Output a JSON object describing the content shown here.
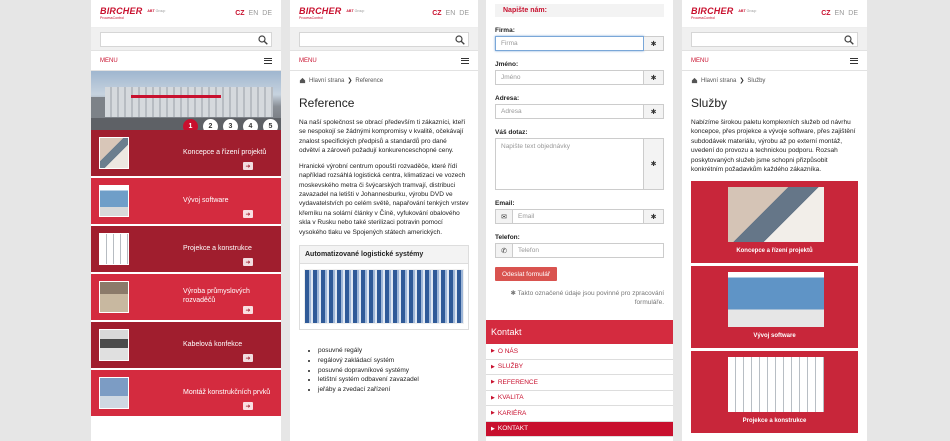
{
  "brand": {
    "name": "BIRCHER",
    "sub": "ProcessControl",
    "group_prefix": "ABT",
    "group_suffix": "Group"
  },
  "languages": [
    "CZ",
    "EN",
    "DE"
  ],
  "menu_label": "MENU",
  "hero_slides": [
    "1",
    "2",
    "3",
    "4",
    "5"
  ],
  "services": [
    {
      "label": "Koncepce a řízení projektů",
      "icon": "person-photo"
    },
    {
      "label": "Vývoj software",
      "icon": "monitor-photo"
    },
    {
      "label": "Projekce a konstrukce",
      "icon": "drawing-photo"
    },
    {
      "label": "Výroba průmyslových rozvaděčů",
      "icon": "factory-photo"
    },
    {
      "label": "Kabelová konfekce",
      "icon": "cable-photo"
    },
    {
      "label": "Montáž konstrukčních prvků",
      "icon": "robot-photo"
    }
  ],
  "reference": {
    "breadcrumb_home": "Hlavní strana",
    "breadcrumb_current": "Reference",
    "title": "Reference",
    "para1": "Na naší společnost se obrací především ti zákazníci, kteří se nespokojí se žádnými kompromisy v kvalitě, očekávají znalost specifických předpisů a standardů pro dané odvětví a zároveň požadují konkurenceschopné ceny.",
    "para2": "Hranické výrobní centrum opouští rozvaděče, které řídí například rozsáhlá logistická centra, klimatizaci ve vozech moskevského metra či švýcarských tramvají, distribuci zavazadel na letišti v Johannesburku, výrobu DVD ve vydavatelstvích po celém světě, napařování tenkých vrstev křemíku na solární články v Číně, vyfukování obalového skla v Rusku nebo také sterilizaci potravin pomocí vysokého tlaku ve Spojených státech amerických.",
    "box_title": "Automatizované logistické systémy",
    "bullets": [
      "posuvné regály",
      "regálový zakládací systém",
      "posuvné dopravníkové systémy",
      "letištní systém odbavení zavazadel",
      "jeřáby a zvedací zařízení"
    ]
  },
  "form": {
    "heading": "Napište nám:",
    "firma_label": "Firma:",
    "firma_placeholder": "Firma",
    "jmeno_label": "Jméno:",
    "jmeno_placeholder": "Jméno",
    "adresa_label": "Adresa:",
    "adresa_placeholder": "Adresa",
    "dotaz_label": "Váš dotaz:",
    "dotaz_placeholder": "Napište text objednávky",
    "email_label": "Email:",
    "email_placeholder": "Email",
    "telefon_label": "Telefon:",
    "telefon_placeholder": "Telefon",
    "required_mark": "✱",
    "submit": "Odeslat formulář",
    "note": "✱ Takto označené údaje jsou povinné pro zpracování formuláře."
  },
  "kontakt": {
    "title": "Kontakt",
    "items": [
      {
        "label": "O NÁS",
        "active": false
      },
      {
        "label": "SLUŽBY",
        "active": false
      },
      {
        "label": "REFERENCE",
        "active": false
      },
      {
        "label": "KVALITA",
        "active": false
      },
      {
        "label": "KARIÉRA",
        "active": false
      },
      {
        "label": "KONTAKT",
        "active": true
      }
    ]
  },
  "sluzby": {
    "breadcrumb_home": "Hlavní strana",
    "breadcrumb_current": "Služby",
    "title": "Služby",
    "intro": "Nabízíme širokou paletu komplexních služeb od návrhu koncepce, přes projekce a vývoje software, přes zajištění subdodávek materiálu, výrobu až po externí montáž, uvedení do provozu a technickou podporu. Rozsah poskytovaných služeb jsme schopni přizpůsobit konkrétním požadavkům každého zákazníka.",
    "cards": [
      {
        "label": "Koncepce a řízení projektů"
      },
      {
        "label": "Vývoj software"
      },
      {
        "label": "Projekce a konstrukce"
      }
    ]
  },
  "colors": {
    "brand_red": "#c8102e",
    "tile_dark": "#a01e2e",
    "tile_light": "#d42b3f"
  }
}
